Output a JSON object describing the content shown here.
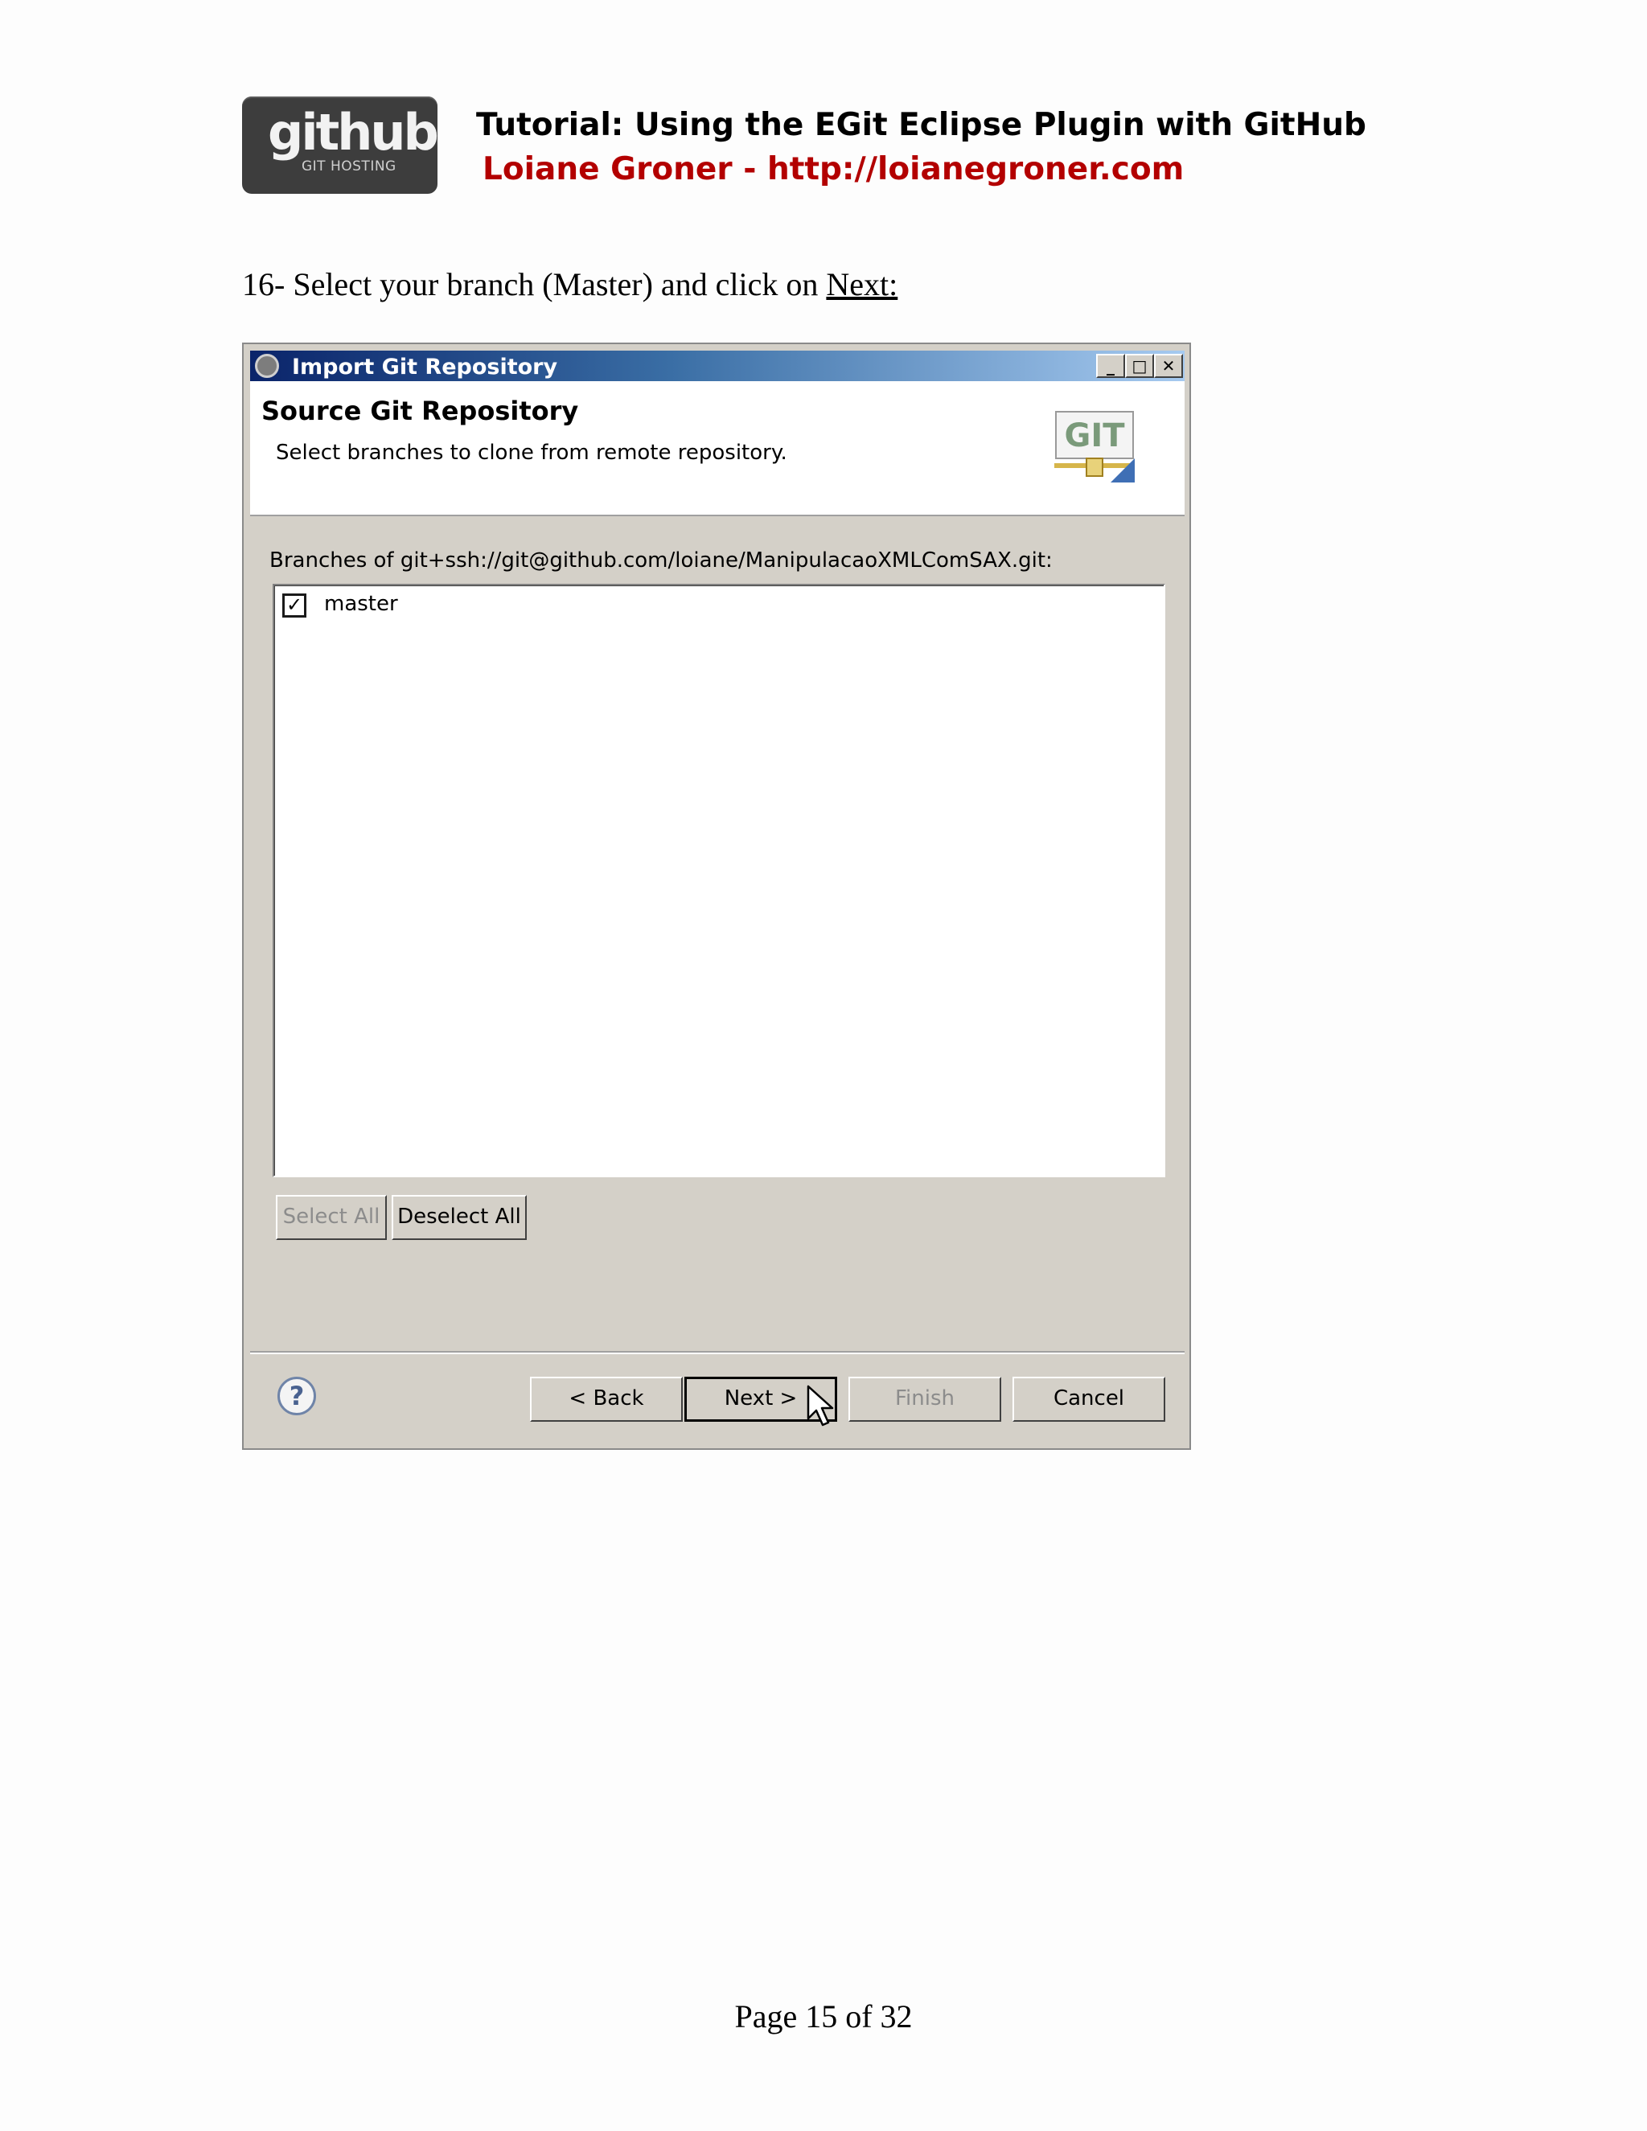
{
  "header": {
    "logo_word": "github",
    "logo_sub": "GIT HOSTING",
    "title": "Tutorial: Using the EGit Eclipse Plugin with GitHub",
    "author": "Loiane Groner - http://loianegroner.com"
  },
  "instruction": {
    "prefix": "16- Select your branch (Master) and click on ",
    "link": "Next:"
  },
  "dialog": {
    "title": "Import Git Repository",
    "window_buttons": [
      "_",
      "□",
      "✕"
    ],
    "banner_title": "Source Git Repository",
    "banner_description": "Select branches to clone from remote repository.",
    "git_logo_text": "GIT",
    "branches_label": "Branches of git+ssh://git@github.com/loiane/ManipulacaoXMLComSAX.git:",
    "branches": [
      {
        "name": "master",
        "checked": true
      }
    ],
    "select_all": "Select All",
    "deselect_all": "Deselect All",
    "back": "< Back",
    "next": "Next >",
    "finish": "Finish",
    "cancel": "Cancel",
    "help_symbol": "?"
  },
  "footer": {
    "page": "Page 15 of 32"
  },
  "colors": {
    "author": "#b30000",
    "dialog_bg": "#d4d0c8",
    "titlebar_start": "#0a246a",
    "titlebar_end": "#a6caf0"
  }
}
